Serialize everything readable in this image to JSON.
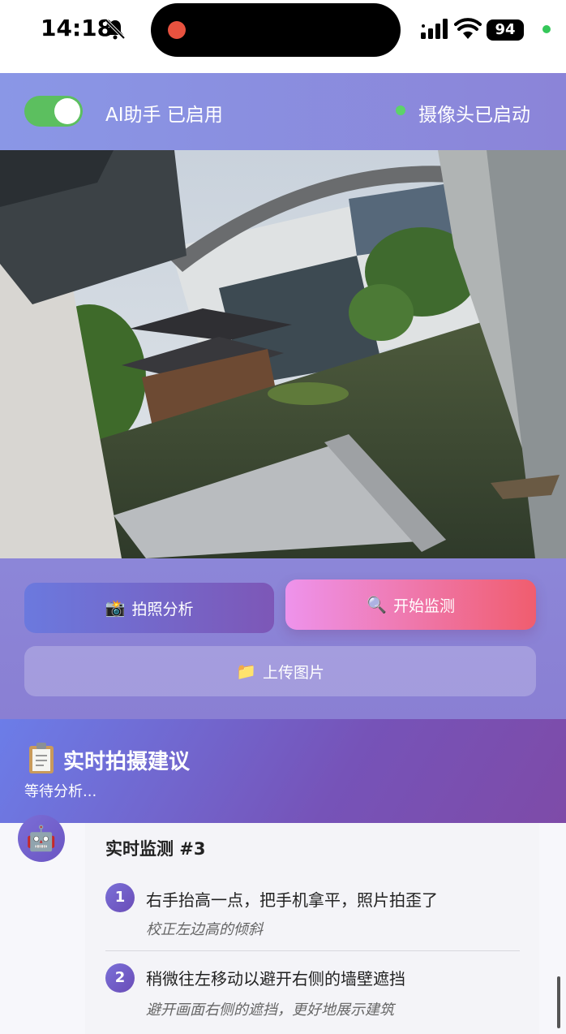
{
  "status_bar": {
    "time": "14:18",
    "battery": "94",
    "icons": [
      "bell-slash-icon",
      "signal-icon",
      "wifi-icon",
      "battery-icon"
    ]
  },
  "header": {
    "ai_toggle_on": true,
    "ai_label": "AI助手 已启用",
    "camera_status": "摄像头已启动",
    "camera_status_color": "#5cd36a"
  },
  "actions": {
    "photo_icon": "📸",
    "photo_label": "拍照分析",
    "monitor_icon": "🔍",
    "monitor_label": "开始监测",
    "upload_icon": "📁",
    "upload_label": "上传图片"
  },
  "suggestions": {
    "icon": "clipboard-icon",
    "title": "实时拍摄建议",
    "status": "等待分析..."
  },
  "result": {
    "avatar": "🤖",
    "title": "实时监测 #3",
    "items": [
      {
        "number": "1",
        "text": "右手抬高一点，把手机拿平，照片拍歪了",
        "note": "校正左边高的倾斜"
      },
      {
        "number": "2",
        "text": "稍微往左移动以避开右侧的墙壁遮挡",
        "note": "避开画面右侧的遮挡，更好地展示建筑"
      }
    ]
  },
  "colors": {
    "header_gradient": [
      "#8a97e6",
      "#8b84d8"
    ],
    "toggle_on": "#5cbf5f",
    "monitor_button": [
      "#ee93ec",
      "#f05d6e"
    ],
    "accent_purple": "#6a4cb7"
  }
}
